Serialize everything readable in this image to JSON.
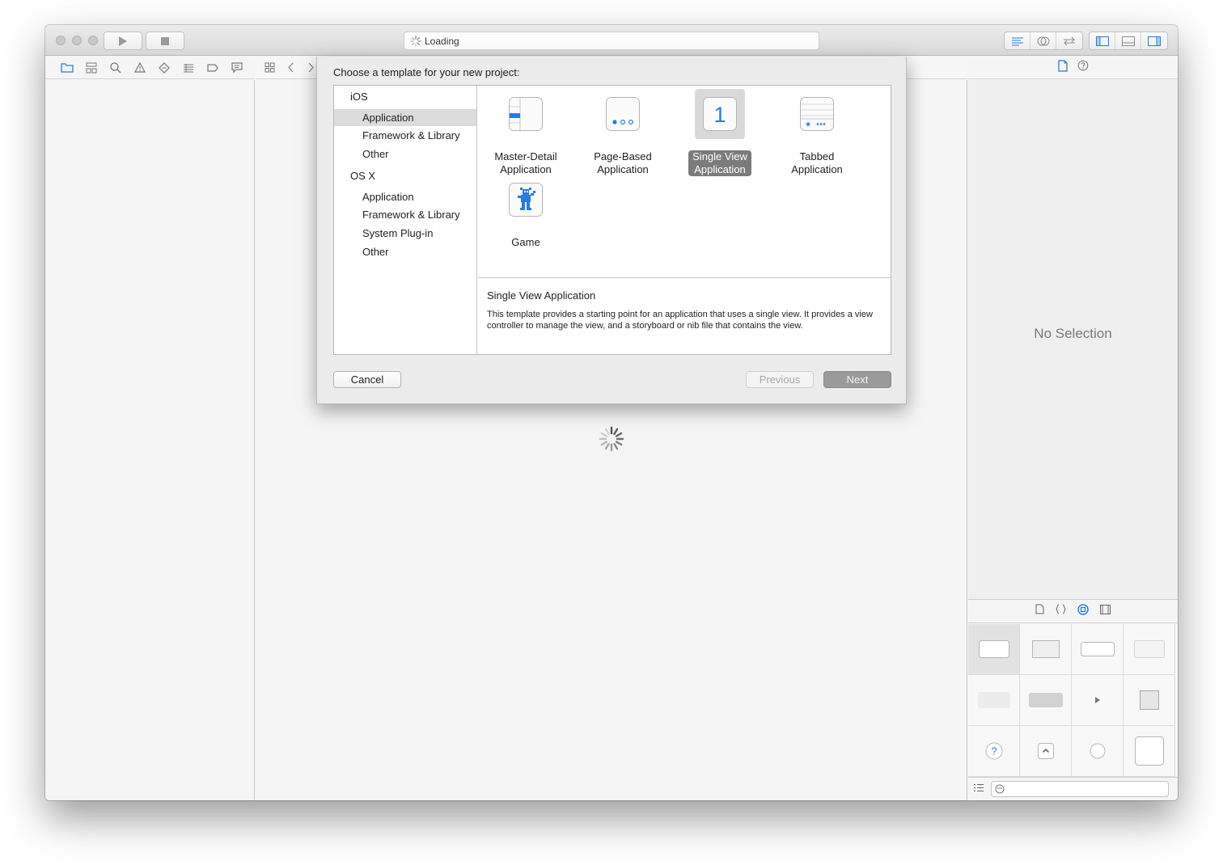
{
  "toolbar": {
    "activity_text": "Loading"
  },
  "inspector": {
    "no_selection": "No Selection"
  },
  "sheet": {
    "title": "Choose a template for your new project:",
    "categories": [
      {
        "label": "iOS",
        "kind": "header"
      },
      {
        "label": "Application",
        "kind": "item",
        "selected": true
      },
      {
        "label": "Framework & Library",
        "kind": "item"
      },
      {
        "label": "Other",
        "kind": "item"
      },
      {
        "label": "OS X",
        "kind": "header"
      },
      {
        "label": "Application",
        "kind": "item"
      },
      {
        "label": "Framework & Library",
        "kind": "item"
      },
      {
        "label": "System Plug-in",
        "kind": "item"
      },
      {
        "label": "Other",
        "kind": "item"
      }
    ],
    "templates": [
      {
        "line1": "Master-Detail",
        "line2": "Application",
        "icon": "master-detail-icon"
      },
      {
        "line1": "Page-Based",
        "line2": "Application",
        "icon": "page-based-icon"
      },
      {
        "line1": "Single View",
        "line2": "Application",
        "icon": "single-view-icon",
        "icon_text": "1",
        "selected": true
      },
      {
        "line1": "Tabbed",
        "line2": "Application",
        "icon": "tabbed-icon"
      },
      {
        "line1": "Game",
        "line2": "",
        "icon": "game-icon"
      }
    ],
    "description": {
      "title": "Single View Application",
      "body": "This template provides a starting point for an application that uses a single view. It provides a view controller to manage the view, and a storyboard or nib file that contains the view."
    },
    "buttons": {
      "cancel": "Cancel",
      "previous": "Previous",
      "next": "Next"
    }
  },
  "colors": {
    "accent": "#2a7ae2",
    "selection_gray": "#7b7b7b"
  }
}
